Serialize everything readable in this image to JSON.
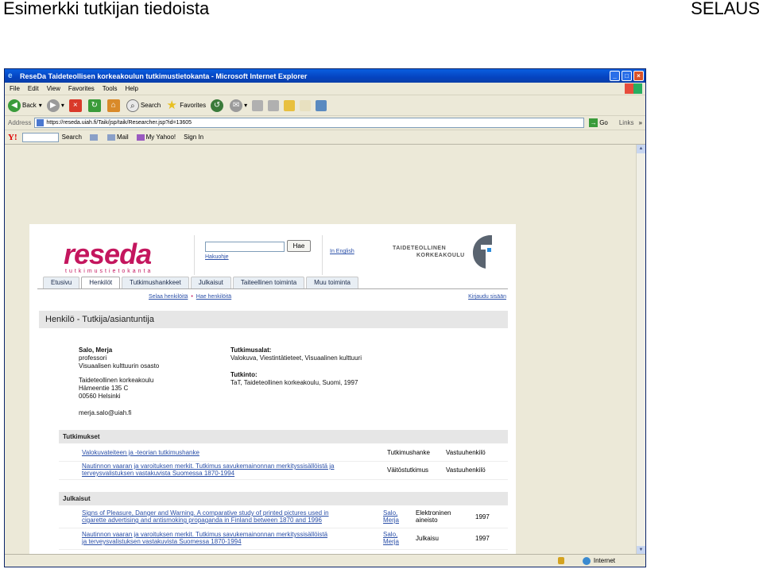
{
  "slide": {
    "title": "Esimerkki tutkijan tiedoista",
    "right_label": "SELAUS"
  },
  "browser": {
    "window_title": "ReseDa Taideteollisen korkeakoulun tutkimustietokanta - Microsoft Internet Explorer",
    "menu": [
      "File",
      "Edit",
      "View",
      "Favorites",
      "Tools",
      "Help"
    ],
    "toolbar": {
      "back": "Back",
      "search": "Search",
      "favorites": "Favorites"
    },
    "address": {
      "label": "Address",
      "url": "https://reseda.uiah.fi/Taik/jsp/taik/Researcher.jsp?id=13605",
      "go": "Go",
      "links": "Links"
    },
    "yahoo": {
      "logo": "Y!",
      "search": "Search",
      "mail": "Mail",
      "my_yahoo": "My Yahoo!",
      "sign_in": "Sign In"
    },
    "status": {
      "zone": "Internet"
    }
  },
  "site": {
    "logo_text": "reseda",
    "logo_sub": "tutkimustietokanta",
    "search_button": "Hae",
    "search_help": "Hakuohje",
    "in_english": "In English",
    "institution_line1": "TAIDETEOLLINEN",
    "institution_line2": "KORKEAKOULU",
    "tabs": [
      "Etusivu",
      "Henkilöt",
      "Tutkimushankkeet",
      "Julkaisut",
      "Taiteellinen toiminta",
      "Muu toiminta"
    ],
    "active_tab": 1,
    "subnav": {
      "browse": "Selaa henkilöitä",
      "search": "Hae henkilöitä"
    },
    "login": "Kirjaudu sisään",
    "section_title": "Henkilö - Tutkija/asiantuntija"
  },
  "person": {
    "name": "Salo, Merja",
    "title": "professori",
    "department": "Visuaalisen kulttuurin osasto",
    "organization": "Taideteollinen korkeakoulu",
    "street": "Hämeentie 135 C",
    "city": "00560 Helsinki",
    "email": "merja.salo@uiah.fi"
  },
  "research": {
    "areas_label": "Tutkimusalat:",
    "areas_value": "Valokuva, Viestintätieteet, Visuaalinen kulttuuri",
    "degree_label": "Tutkinto:",
    "degree_value": "TaT, Taideteollinen korkeakoulu, Suomi, 1997"
  },
  "projects": {
    "header": "Tutkimukset",
    "rows": [
      {
        "title_line1": "Valokuvateiteen ja -teorian tutkimushanke",
        "title_line2": "",
        "type": "Tutkimushanke",
        "role": "Vastuuhenkilö"
      },
      {
        "title_line1": "Nautinnon vaaran ja varoituksen merkit. Tutkimus savukemainonnan merkityssisällöistä ja",
        "title_line2": "terveysvalistuksen vastakuvista Suomessa 1870-1994",
        "type": "Väitöstutkimus",
        "role": "Vastuuhenkilö"
      }
    ]
  },
  "publications": {
    "header": "Julkaisut",
    "rows": [
      {
        "title_line1": "Signs of Pleasure, Danger and Warning. A comparative study of printed pictures used in",
        "title_line2": "cigarette advertising and antismoking propaganda in Finland between 1870 and 1996",
        "author_line1": "Salo,",
        "author_line2": "Merja",
        "type_line1": "Elektroninen",
        "type_line2": "aineisto",
        "year": "1997"
      },
      {
        "title_line1": "Nautinnon vaaran ja varoituksen merkit. Tutkimus savukemainonnan merkityssisällöistä",
        "title_line2": "ja terveysvalistuksen vastakuvista Suomessa 1870-1994",
        "author_line1": "Salo,",
        "author_line2": "Merja",
        "type_line1": "Julkaisu",
        "type_line2": "",
        "year": "1997"
      }
    ]
  }
}
